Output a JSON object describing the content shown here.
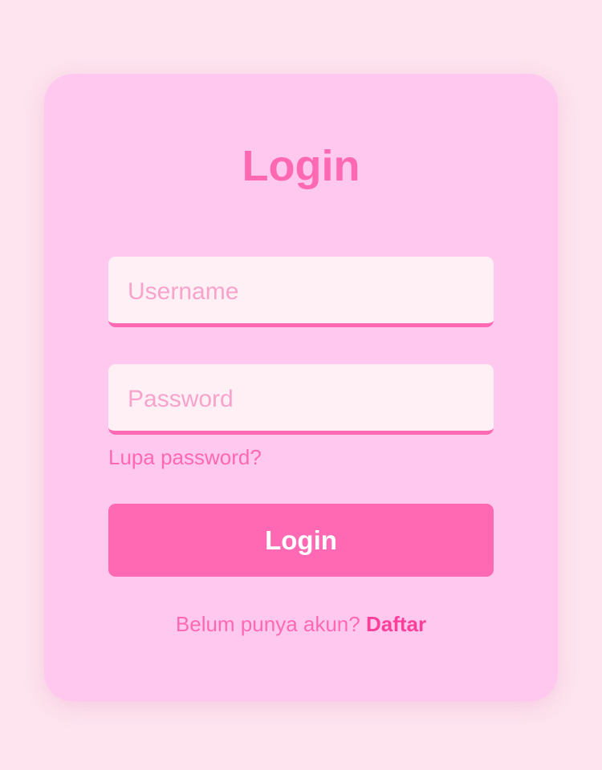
{
  "login_form": {
    "title": "Login",
    "username_placeholder": "Username",
    "password_placeholder": "Password",
    "forgot_password_label": "Lupa password?",
    "submit_label": "Login",
    "signup_prompt": "Belum punya akun?",
    "signup_link_label": "Daftar"
  },
  "colors": {
    "page_background": "#fde4ef",
    "card_background": "#ffc8ef",
    "accent": "#ff69b4",
    "input_background": "#fff0f6",
    "link_emphasis": "#ff3f9a"
  }
}
